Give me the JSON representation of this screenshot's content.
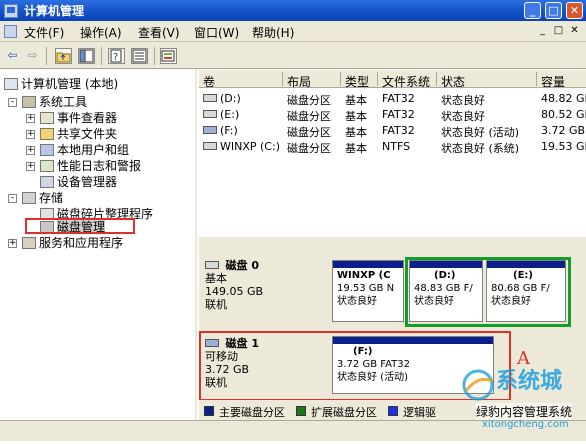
{
  "window": {
    "title": "计算机管理",
    "buttons": {
      "min": "_",
      "max": "□",
      "close": "✕"
    }
  },
  "menu": {
    "items": [
      "文件(F)",
      "操作(A)",
      "查看(V)",
      "窗口(W)",
      "帮助(H)"
    ],
    "sub_buttons": [
      "_",
      "□",
      "✕"
    ]
  },
  "toolbar": {
    "back": "⇦",
    "forward": "⇨",
    "icons": [
      "up-folder-icon",
      "show-hide-tree-icon",
      "help-icon",
      "properties-icon",
      "export-icon"
    ]
  },
  "tree": {
    "root": "计算机管理 (本地)",
    "system_tools": "系统工具",
    "event_viewer": "事件查看器",
    "shared_folders": "共享文件夹",
    "local_users": "本地用户和组",
    "perf_logs": "性能日志和警报",
    "device_manager": "设备管理器",
    "storage": "存储",
    "defrag": "磁盘碎片整理程序",
    "disk_mgmt": "磁盘管理",
    "services": "服务和应用程序",
    "expand": "+",
    "collapse": "-"
  },
  "volumes": {
    "headers": [
      "卷",
      "布局",
      "类型",
      "文件系统",
      "状态",
      "容量"
    ],
    "rows": [
      [
        "(D:)",
        "磁盘分区",
        "基本",
        "FAT32",
        "状态良好",
        "48.82 GB"
      ],
      [
        "(E:)",
        "磁盘分区",
        "基本",
        "FAT32",
        "状态良好",
        "80.52 GB"
      ],
      [
        "(F:)",
        "磁盘分区",
        "基本",
        "FAT32",
        "状态良好 (活动)",
        "3.72 GB"
      ],
      [
        "WINXP (C:)",
        "磁盘分区",
        "基本",
        "NTFS",
        "状态良好 (系统)",
        "19.53 GB"
      ]
    ]
  },
  "disks": {
    "disk0": {
      "name": "磁盘 0",
      "type": "基本",
      "size": "149.05 GB",
      "status": "联机",
      "partitions": [
        {
          "label": "WINXP (C",
          "detail": "19.53 GB N",
          "status": "状态良好"
        },
        {
          "label": "(D:)",
          "detail": "48.83 GB F/",
          "status": "状态良好"
        },
        {
          "label": "(E:)",
          "detail": "80.68 GB F/",
          "status": "状态良好"
        }
      ]
    },
    "disk1": {
      "name": "磁盘 1",
      "type": "可移动",
      "size": "3.72 GB",
      "status": "联机",
      "partition": {
        "label": "(F:)",
        "detail": "3.72 GB FAT32",
        "status": "状态良好 (活动)"
      }
    },
    "annotation": "A"
  },
  "legend": {
    "items": [
      "主要磁盘分区",
      "扩展磁盘分区",
      "逻辑驱"
    ],
    "colors": [
      "#0a1e8c",
      "#1a7a1a",
      "#2030e8"
    ]
  },
  "watermark": {
    "brand": "系统城",
    "site": "xitongcheng.com",
    "overlay": "绿豹内容管理系统"
  },
  "colors": {
    "titlebar": "#1553c8",
    "highlight": "#e0302a",
    "green_frame": "#139d2a",
    "partition_bar": "#0a1e8c"
  }
}
